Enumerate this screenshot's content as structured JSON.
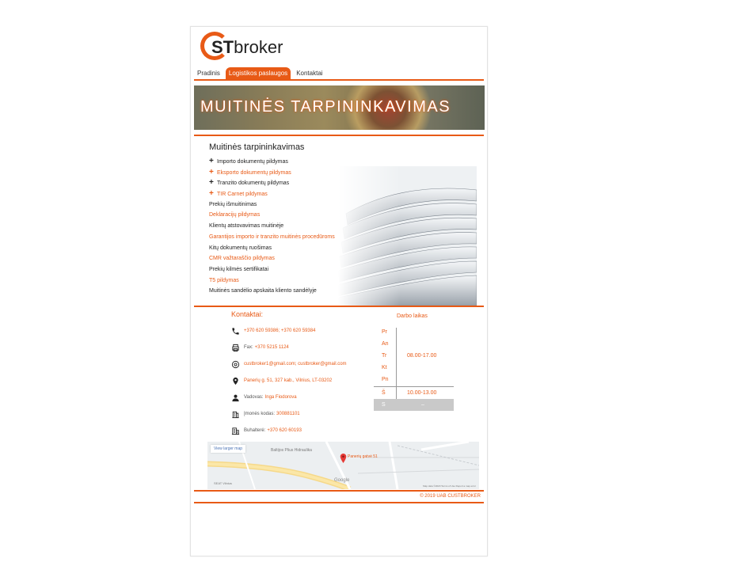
{
  "logo": {
    "bold": "ST",
    "rest": "broker"
  },
  "nav": {
    "items": [
      {
        "label": "Pradinis"
      },
      {
        "label": "Logistikos paslaugos"
      },
      {
        "label": "Kontaktai"
      }
    ]
  },
  "banner": {
    "title": "MUITINĖS TARPININKAVIMAS"
  },
  "services": {
    "heading": "Muitinės tarpininkavimas",
    "items": [
      {
        "label": "Importo dokumentų pildymas"
      },
      {
        "label": "Eksporto dokumentų pildymas"
      },
      {
        "label": "Tranzito dokumentų pildymas"
      },
      {
        "label": "TIR Carnet pildymas"
      },
      {
        "label": "Prekių išmuitinimas"
      },
      {
        "label": "Deklaracijų pildymas"
      },
      {
        "label": "Klientų atstovavimas muitinėje"
      },
      {
        "label": "Garantijos importo ir tranzito muitinės procedūroms"
      },
      {
        "label": "Kitų dokumentų ruošimas"
      },
      {
        "label": "CMR važtaraščio pildymas"
      },
      {
        "label": "Prekių kilmės sertifikatai"
      },
      {
        "label": "T5 pildymas"
      },
      {
        "label": "Muitinės sandėlio apskaita kliento sandėlyje"
      }
    ]
  },
  "contacts": {
    "title": "Kontaktai:",
    "phone": "+370 620 59386; +370 620 59384",
    "fax_label": "Fax:",
    "fax": "+370 5215 1124",
    "email": "custbroker1@gmail.com; custbroker@gmail.com",
    "address": "Panerių g. 51, 327 kab., Vilnius, LT-03202",
    "manager_label": "Vadovas:",
    "manager": "Inga Fiodorova",
    "company_code_label": "Įmonės kodas:",
    "company_code": "300881101",
    "accountant_label": "Buhalterė:",
    "accountant": "+370 620 60193"
  },
  "hours": {
    "title": "Darbo laikas",
    "days": [
      {
        "day": "Pr"
      },
      {
        "day": "An"
      },
      {
        "day": "Tr"
      },
      {
        "day": "Kt"
      },
      {
        "day": "Pn"
      }
    ],
    "weekday_time": "08.00-17.00",
    "saturday": "Š",
    "saturday_time": "10.00-13.00",
    "sunday": "S",
    "sunday_time": "–"
  },
  "map": {
    "larger_link": "View larger map",
    "pin_label": "Panerių gatvė 51",
    "place1": "Baltijos Plius Hidraulika",
    "place2": "SEAT Vilnius",
    "google": "Google",
    "attribution": "Map data ©2020   Terms of Use   Report a map error"
  },
  "footer": {
    "copyright": "© 2019 UAB CUSTBROKER"
  },
  "colors": {
    "accent": "#e85a16",
    "text": "#333333"
  },
  "icons": [
    "phone-icon",
    "fax-icon",
    "email-icon",
    "location-pin-icon",
    "person-icon",
    "building-icon",
    "office-icon",
    "map-pin-icon"
  ]
}
